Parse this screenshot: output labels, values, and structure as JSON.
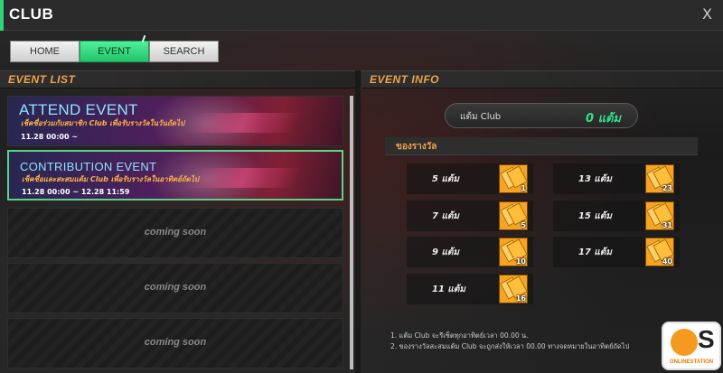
{
  "window": {
    "title": "CLUB",
    "close_label": "X",
    "accent_color": "#2fd37a"
  },
  "tabs": [
    {
      "label": "HOME",
      "active": false
    },
    {
      "label": "EVENT",
      "active": true
    },
    {
      "label": "SEARCH",
      "active": false
    }
  ],
  "event_list": {
    "header": "EVENT LIST",
    "events": [
      {
        "name": "ATTEND EVENT",
        "description": "เช็คชื่อร่วมกับสมาชิก Club เพื่อรับรางวัลในวันถัดไป",
        "dates": "11.28 00:00 ~",
        "selected": false
      },
      {
        "name": "CONTRIBUTION EVENT",
        "description": "เช็คชื่อและสะสมแต้ม Club เพื่อรับรางวัลในอาทิตย์ถัดไป",
        "dates": "11.28 00:00 ~ 12.28 11:59",
        "selected": true
      }
    ],
    "coming_soon": [
      "coming soon",
      "coming soon",
      "coming soon"
    ]
  },
  "event_info": {
    "header": "EVENT INFO",
    "points_label": "แต้ม Club",
    "points_value": "0 แต้ม",
    "rewards_header": "ของรางวัล",
    "rewards": [
      {
        "label": "5 แต้ม",
        "qty": "1"
      },
      {
        "label": "13 แต้ม",
        "qty": "23"
      },
      {
        "label": "7 แต้ม",
        "qty": "5"
      },
      {
        "label": "15 แต้ม",
        "qty": "31"
      },
      {
        "label": "9 แต้ม",
        "qty": "10"
      },
      {
        "label": "17 แต้ม",
        "qty": "40"
      },
      {
        "label": "11 แต้ม",
        "qty": "16"
      }
    ],
    "notes": [
      "1. แต้ม Club จะรีเซ็ตทุกอาทิตย์เวลา 00.00 น.",
      "2. ของรางวัลสะสมแต้ม Club จะถูกส่งให้เวลา 00.00 ทางจดหมายในอาทิตย์ถัดไป"
    ]
  },
  "watermark": {
    "letter": "S",
    "text": "ONLINESTATION"
  }
}
